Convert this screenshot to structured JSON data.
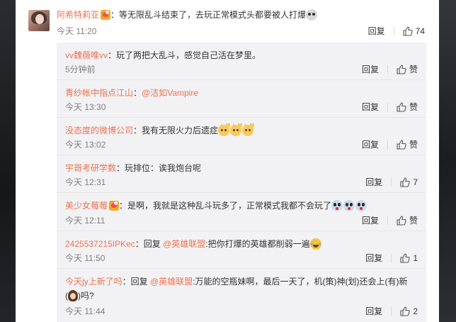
{
  "main_comment": {
    "author": "阿希特莉亚",
    "text_before_emoji": "：等无限乱斗结束了，去玩正常模式头都要被人打爆",
    "emoji": "skull",
    "time": "今天 11:20",
    "reply_label": "回复",
    "likes": "74"
  },
  "replies": [
    {
      "author": "vv魏薇唯vv",
      "text": "：玩了两把大乱斗，感觉自己活在梦里。",
      "time": "5分钟前",
      "reply_label": "回复",
      "likes": "赞"
    },
    {
      "author": "青纱帐中指点江山",
      "text": "：",
      "mention": "@洁如Vampire",
      "time": "今天 13:30",
      "reply_label": "回复",
      "likes": "赞"
    },
    {
      "author": "没态度的微博公司",
      "text": "：我有无限火力后遗症",
      "emojis": [
        "cat",
        "cat",
        "cat"
      ],
      "time": "今天 13:02",
      "reply_label": "回复",
      "likes": "赞"
    },
    {
      "author": "宇哥考研学数",
      "text": "：玩排位：诶我炮台呢",
      "time": "今天 12:31",
      "reply_label": "回复",
      "likes": "7"
    },
    {
      "author": "美少女莓莓",
      "text": "：是啊，我就是这种乱斗玩多了，正常模式我都不会玩了",
      "emojis": [
        "scared",
        "scared",
        "scared"
      ],
      "time": "今天 12:11",
      "reply_label": "回复",
      "likes": "赞"
    },
    {
      "author": "2425537215IPKec",
      "prefix": "：回复 ",
      "mention": "@英雄联盟",
      "text": ":把你打爆的英雄都削弱一遍",
      "emojis": [
        "laugh"
      ],
      "time": "今天 11:50",
      "reply_label": "回复",
      "likes": "1"
    },
    {
      "author": "今天jy上新了吗",
      "prefix": "：回复 ",
      "mention": "@英雄联盟",
      "text": ":万能的空瓶妹啊，最后一天了，机(策)神(划)还会上(有)新",
      "text_line2_before": "(",
      "text_line2_after": ")吗?",
      "time": "今天 11:44",
      "reply_label": "回复",
      "likes": "2"
    }
  ],
  "colors": {
    "name": "#eb7350",
    "meta": "#808080",
    "reply_bg": "#f2f2f5"
  }
}
